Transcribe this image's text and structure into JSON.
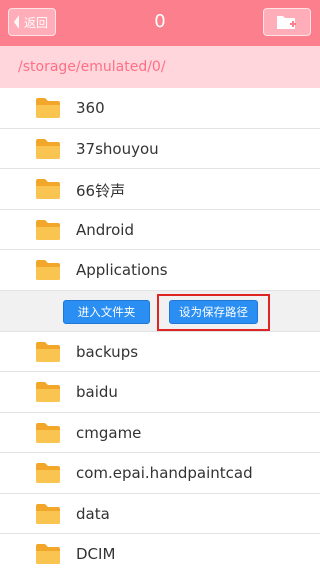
{
  "header": {
    "back_label": "返回",
    "title": "0",
    "new_folder_icon": "new-folder-icon"
  },
  "path": "/storage/emulated/0/",
  "folders_top": [
    {
      "name": "360"
    },
    {
      "name": "37shouyou"
    },
    {
      "name": "66铃声"
    },
    {
      "name": "Android"
    },
    {
      "name": "Applications"
    }
  ],
  "actions": {
    "enter_label": "进入文件夹",
    "save_label": "设为保存路径"
  },
  "folders_bottom": [
    {
      "name": "backups"
    },
    {
      "name": "baidu"
    },
    {
      "name": "cmgame"
    },
    {
      "name": "com.epai.handpaintcad"
    },
    {
      "name": "data"
    },
    {
      "name": "DCIM"
    }
  ],
  "colors": {
    "header": "#fb7f8c",
    "path_bar": "#ffd6dc",
    "path_text": "#ff6f86",
    "button": "#2b8ef2",
    "highlight": "#e02424",
    "folder": "#f6b73c"
  }
}
